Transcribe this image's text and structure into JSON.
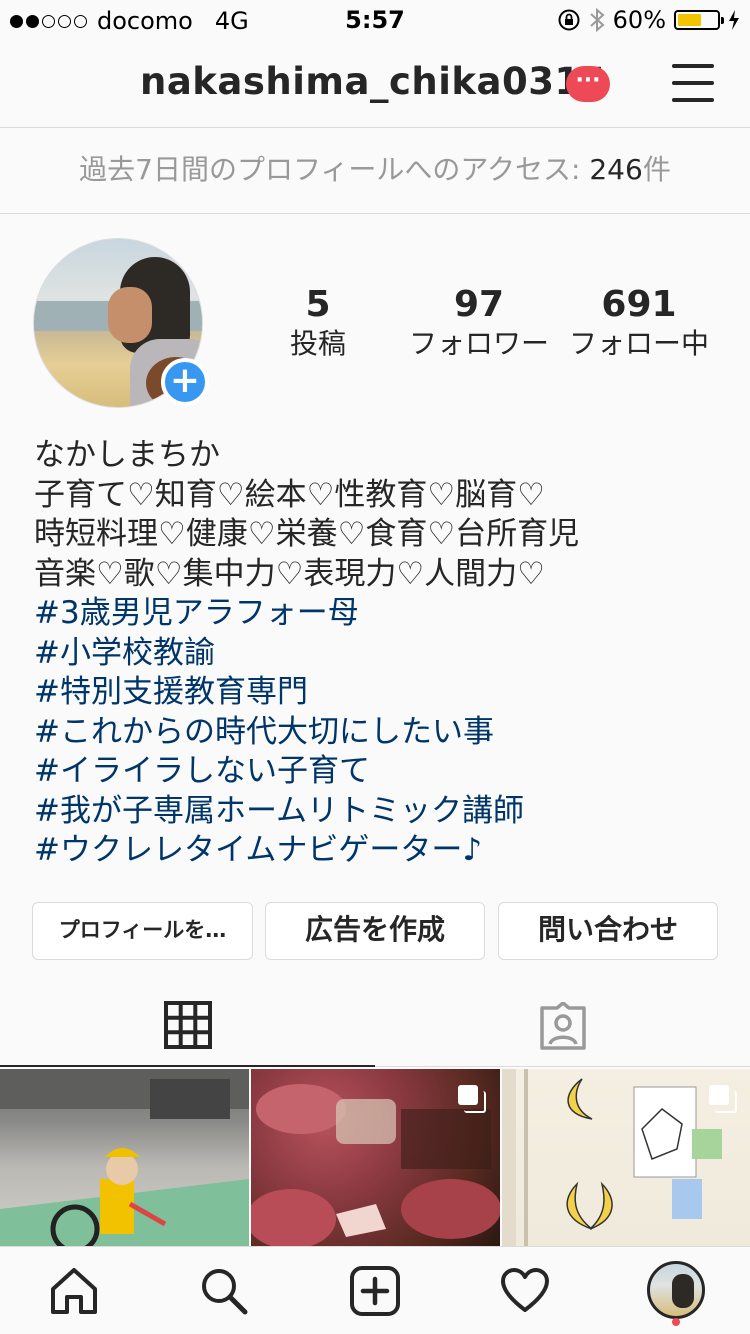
{
  "status_bar": {
    "carrier": "docomo",
    "network": "4G",
    "time": "5:57",
    "battery_percent": "60%",
    "signal_bars_filled": 2,
    "signal_bars_total": 5
  },
  "header": {
    "username": "nakashima_chika0314",
    "more_badge": "···"
  },
  "insights": {
    "label": "過去7日間のプロフィールへのアクセス: ",
    "count": "246",
    "unit": "件"
  },
  "profile": {
    "add_icon": "+",
    "stats": {
      "posts": {
        "value": "5",
        "label": "投稿"
      },
      "followers": {
        "value": "97",
        "label": "フォロワー"
      },
      "following": {
        "value": "691",
        "label": "フォロー中"
      }
    },
    "bio": {
      "name": "なかしまちか",
      "lines": [
        "子育て♡知育♡絵本♡性教育♡脳育♡",
        "時短料理♡健康♡栄養♡食育♡台所育児",
        "音楽♡歌♡集中力♡表現力♡人間力♡"
      ],
      "hashtags": [
        "#3歳男児アラフォー母",
        "#小学校教諭",
        "#特別支援教育専門",
        "#これからの時代大切にしたい事",
        "#イライラしない子育て",
        "#我が子専属ホームリトミック講師",
        "#ウクレレタイムナビゲーター♪"
      ]
    }
  },
  "actions": {
    "edit_profile": "プロフィールを…",
    "create_ad": "広告を作成",
    "contact": "問い合わせ"
  },
  "tabs": [
    {
      "icon": "grid-icon",
      "active": true
    },
    {
      "icon": "tagged-icon",
      "active": false
    }
  ],
  "posts": [
    {
      "type": "single",
      "icon": ""
    },
    {
      "type": "carousel",
      "icon": "multiple-photos-icon"
    },
    {
      "type": "carousel",
      "icon": "multiple-photos-icon"
    }
  ],
  "bottom_nav": [
    {
      "icon": "home-icon"
    },
    {
      "icon": "search-icon"
    },
    {
      "icon": "add-post-icon"
    },
    {
      "icon": "heart-icon"
    },
    {
      "icon": "profile-avatar"
    }
  ],
  "colors": {
    "accent": "#3897f0",
    "hashtag": "#003569",
    "notification": "#ed4956",
    "battery": "#f5c400"
  }
}
